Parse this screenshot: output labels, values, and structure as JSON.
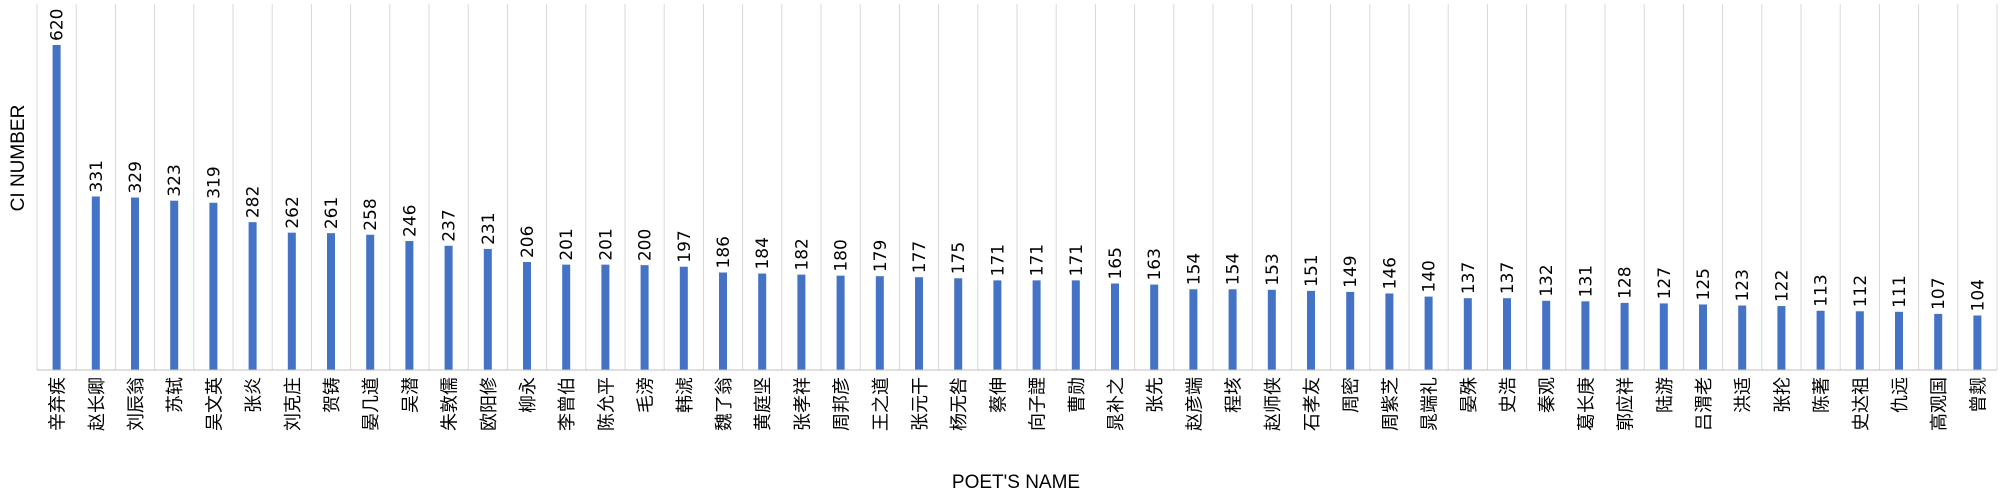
{
  "chart_data": {
    "type": "bar",
    "xlabel": "POET'S NAME",
    "ylabel": "CI NUMBER",
    "ylim": [
      0,
      620
    ],
    "grid": "vertical",
    "bar_color": "#4472c4",
    "grid_color": "#d9d9d9",
    "categories": [
      "辛弃疾",
      "赵长卿",
      "刘辰翁",
      "苏轼",
      "吴文英",
      "张炎",
      "刘克庄",
      "贺铸",
      "晏几道",
      "吴潜",
      "朱敦儒",
      "欧阳修",
      "柳永",
      "李曾伯",
      "陈允平",
      "毛滂",
      "韩淲",
      "魏了翁",
      "黄庭坚",
      "张孝祥",
      "周邦彦",
      "王之道",
      "张元干",
      "杨无咎",
      "蔡伸",
      "向子諲",
      "曹勋",
      "晁补之",
      "张先",
      "赵彦端",
      "程垓",
      "赵师侠",
      "石孝友",
      "周密",
      "周紫芝",
      "晁端礼",
      "晏殊",
      "史浩",
      "秦观",
      "葛长庚",
      "郭应祥",
      "陆游",
      "吕渭老",
      "洪适",
      "张抡",
      "陈著",
      "史达祖",
      "仇远",
      "高观国",
      "曾觌"
    ],
    "values": [
      620,
      331,
      329,
      323,
      319,
      282,
      262,
      261,
      258,
      246,
      237,
      231,
      206,
      201,
      201,
      200,
      197,
      186,
      184,
      182,
      180,
      179,
      177,
      175,
      171,
      171,
      171,
      165,
      163,
      154,
      154,
      153,
      151,
      149,
      146,
      140,
      137,
      137,
      132,
      131,
      128,
      127,
      125,
      123,
      122,
      113,
      112,
      111,
      107,
      104
    ]
  }
}
